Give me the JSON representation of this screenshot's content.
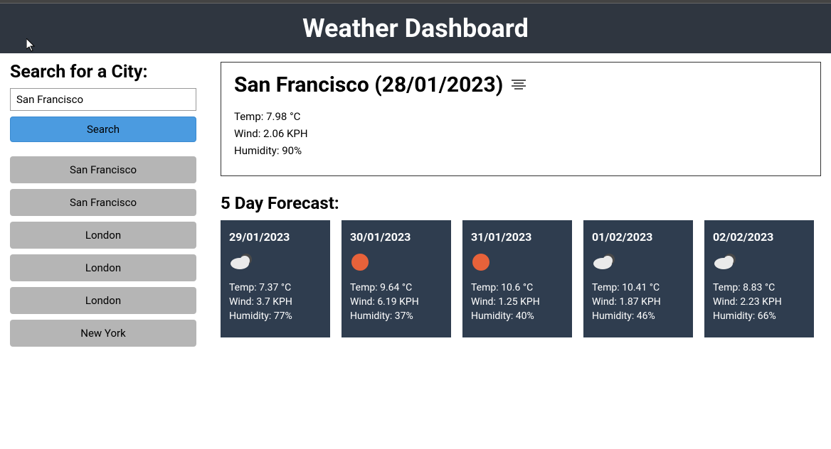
{
  "header": {
    "title": "Weather Dashboard"
  },
  "search": {
    "heading": "Search for a City:",
    "input_value": "San Francisco",
    "button_label": "Search"
  },
  "history": {
    "items": [
      {
        "label": "San Francisco"
      },
      {
        "label": "San Francisco"
      },
      {
        "label": "London"
      },
      {
        "label": "London"
      },
      {
        "label": "London"
      },
      {
        "label": "New York"
      }
    ]
  },
  "current": {
    "title": "San Francisco (28/01/2023)",
    "icon": "fog-icon",
    "temp_line": "Temp: 7.98 °C",
    "wind_line": "Wind: 2.06 KPH",
    "humidity_line": "Humidity: 90%"
  },
  "forecast": {
    "title": "5 Day Forecast:",
    "days": [
      {
        "date": "29/01/2023",
        "icon": "cloud",
        "temp": "Temp: 7.37 °C",
        "wind": "Wind: 3.7 KPH",
        "humidity": "Humidity: 77%"
      },
      {
        "date": "30/01/2023",
        "icon": "sun",
        "temp": "Temp: 9.64 °C",
        "wind": "Wind: 6.19 KPH",
        "humidity": "Humidity: 37%"
      },
      {
        "date": "31/01/2023",
        "icon": "sun",
        "temp": "Temp: 10.6 °C",
        "wind": "Wind: 1.25 KPH",
        "humidity": "Humidity: 40%"
      },
      {
        "date": "01/02/2023",
        "icon": "cloud",
        "temp": "Temp: 10.41 °C",
        "wind": "Wind: 1.87 KPH",
        "humidity": "Humidity: 46%"
      },
      {
        "date": "02/02/2023",
        "icon": "cloud",
        "temp": "Temp: 8.83 °C",
        "wind": "Wind: 2.23 KPH",
        "humidity": "Humidity: 66%"
      }
    ]
  }
}
